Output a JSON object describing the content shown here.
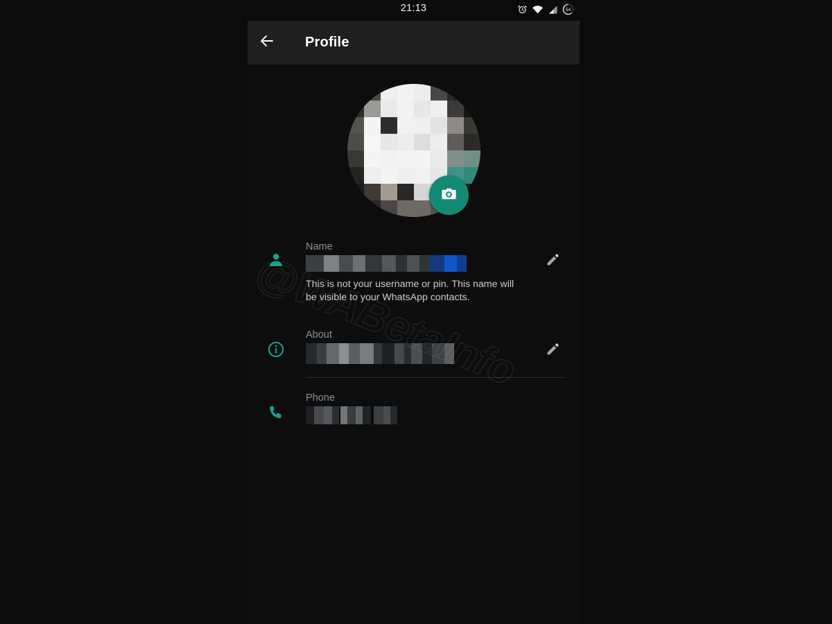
{
  "theme": {
    "page_bg": "#0b0b0b",
    "screen_bg": "#0d0d0d",
    "appbar_bg": "#1f1f1f",
    "accent_teal": "#14a18a",
    "fab_teal": "#138a74",
    "label_grey": "#8d9194",
    "hint_grey": "#c9cccd",
    "divider": "#2b2b2b",
    "text_white": "#ffffff"
  },
  "statusbar": {
    "time": "21:13",
    "icons": [
      "alarm-icon",
      "wifi-icon",
      "signal-icon",
      "battery-icon"
    ],
    "battery_level": "54"
  },
  "appbar": {
    "back_icon": "arrow-left-icon",
    "title": "Profile"
  },
  "avatar": {
    "name": "profile-photo",
    "state": "censored",
    "camera_button_icon": "camera-icon",
    "camera_button_label": "Change profile photo"
  },
  "watermark": {
    "text": "@WABetaInfo"
  },
  "fields": [
    {
      "key": "name",
      "icon": "person-icon",
      "label": "Name",
      "value": "",
      "value_state": "censored",
      "hint": "This is not your username or pin. This name will be visible to your WhatsApp contacts.",
      "edit_icon": "pencil-icon",
      "has_divider": false
    },
    {
      "key": "about",
      "icon": "info-icon",
      "label": "About",
      "value": "",
      "value_state": "censored",
      "hint": "",
      "edit_icon": "pencil-icon",
      "has_divider": true
    },
    {
      "key": "phone",
      "icon": "phone-icon",
      "label": "Phone",
      "value": "",
      "value_state": "censored",
      "hint": "",
      "edit_icon": "",
      "has_divider": false
    }
  ]
}
